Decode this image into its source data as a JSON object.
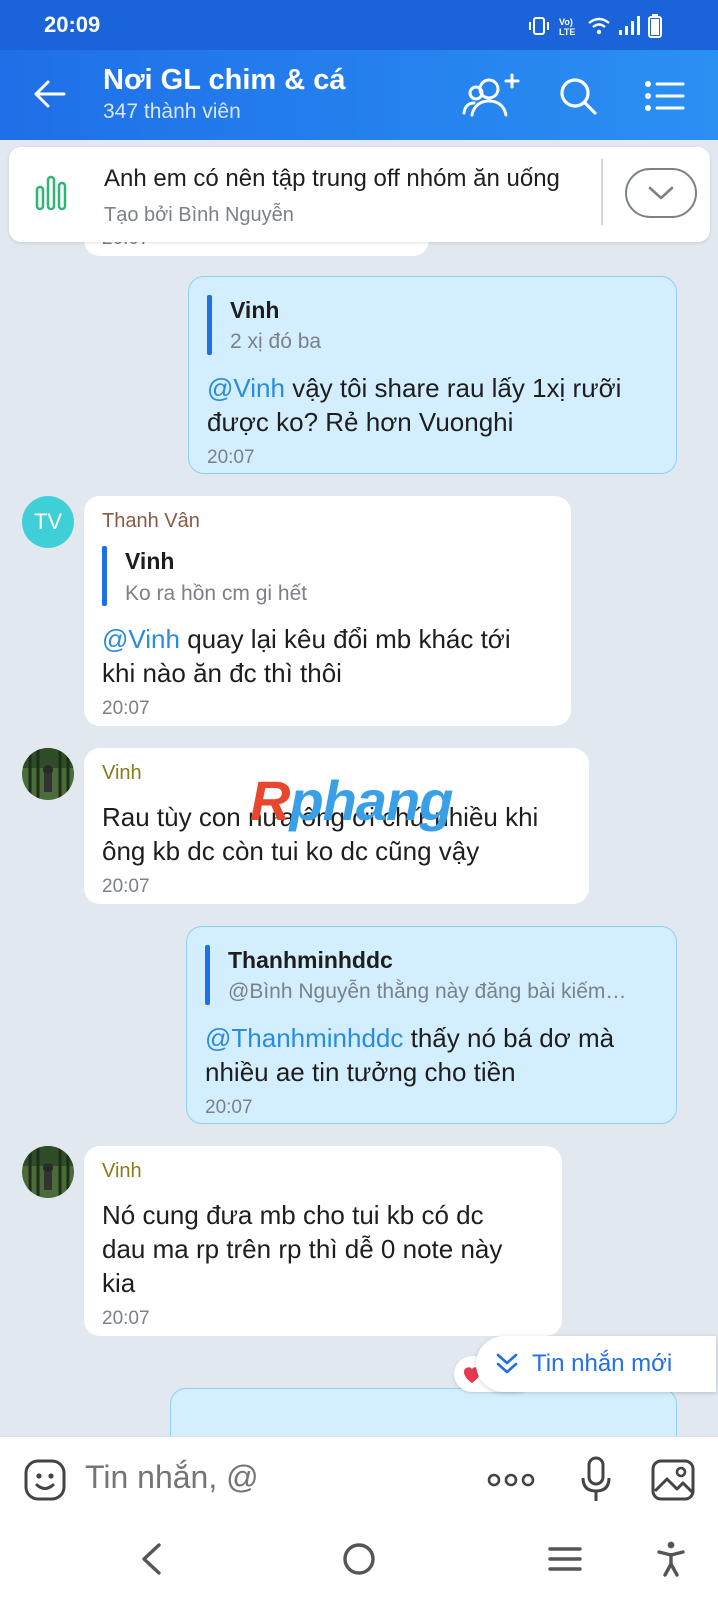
{
  "status": {
    "time": "20:09"
  },
  "header": {
    "title": "Nơi GL chim & cá",
    "subtitle": "347 thành viên"
  },
  "poll": {
    "title": "Anh em có nên tập trung off nhóm ăn uống",
    "creator": "Tạo bởi Bình Nguyễn"
  },
  "messages": [
    {
      "time": "20:07"
    },
    {
      "quote_name": "Vinh",
      "quote_text": "2 xị đó ba",
      "mention": "@Vinh",
      "text_a": " vậy tôi share rau lấy 1xị rưỡi",
      "text_b": "được ko? Rẻ hơn Vuonghi",
      "time": "20:07"
    },
    {
      "avatar": "TV",
      "sender": "Thanh Vân",
      "quote_name": "Vinh",
      "quote_text": "Ko ra hồn cm gi hết",
      "mention": "@Vinh",
      "text_a": " quay lại kêu đổi mb khác tới",
      "text_b": "khi nào ăn đc thì thôi",
      "time": "20:07"
    },
    {
      "sender": "Vinh",
      "text_a": "Rau tùy con nưa ông ơi chứ nhiều khi",
      "text_b": "ông kb dc còn tui ko dc cũng vậy",
      "time": "20:07"
    },
    {
      "quote_name": "Thanhminhddc",
      "quote_text": "@Bình Nguyễn thằng này đăng bài kiếm…",
      "mention": "@Thanhminhddc",
      "text_a": " thấy nó bá dơ mà",
      "text_b": "nhiều ae tin tưởng cho tiền",
      "time": "20:07"
    },
    {
      "sender": "Vinh",
      "text_a": "Nó cung đưa mb cho tui kb có dc",
      "text_b": "dau ma rp trên rp thì dễ 0 note này",
      "text_c": "kia",
      "time": "20:07"
    }
  ],
  "watermark": {
    "part_a": "R",
    "part_b": "phang"
  },
  "new_messages_label": "Tin nhắn mới",
  "composer": {
    "placeholder": "Tin nhắn, @"
  },
  "colors": {
    "header": "#1f6fe8",
    "my_bubble": "#d3efff",
    "mention": "#2a8be0",
    "sender_tv": "#8a5a44",
    "sender_vinh": "#8a7a1a"
  }
}
